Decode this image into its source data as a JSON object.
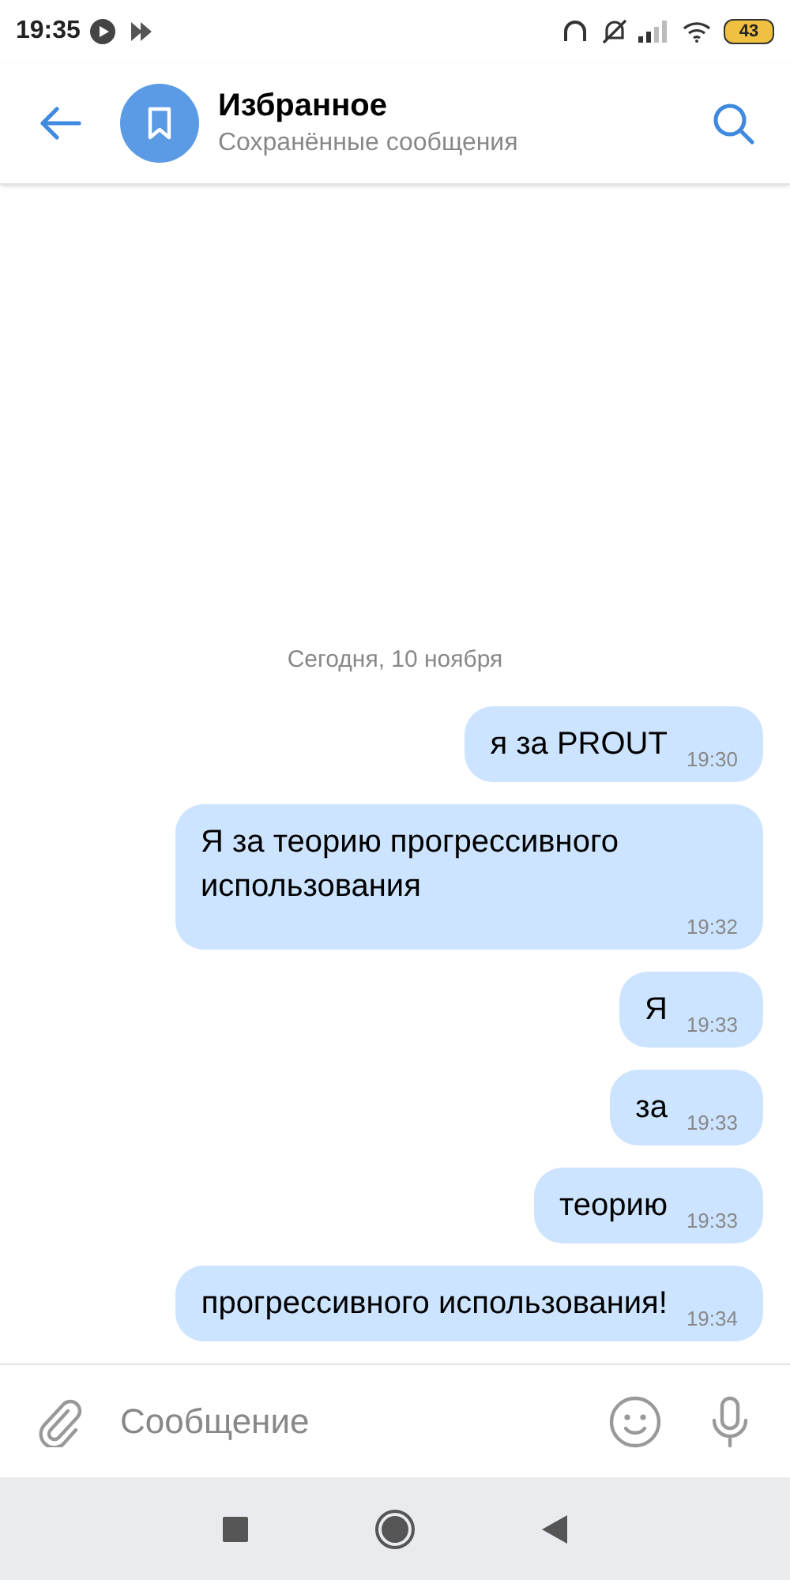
{
  "status_bar": {
    "time": "19:35",
    "battery": "43"
  },
  "header": {
    "title": "Избранное",
    "subtitle": "Сохранённые сообщения"
  },
  "date_divider": "Сегодня, 10 ноября",
  "messages": [
    {
      "text": "я за PROUT",
      "time": "19:30"
    },
    {
      "text": "Я за теорию прогрессивного использования",
      "time": "19:32"
    },
    {
      "text": "Я",
      "time": "19:33"
    },
    {
      "text": "за",
      "time": "19:33"
    },
    {
      "text": "теорию",
      "time": "19:33"
    },
    {
      "text": "прогрессивного использования!",
      "time": "19:34"
    }
  ],
  "composer": {
    "placeholder": "Сообщение"
  }
}
